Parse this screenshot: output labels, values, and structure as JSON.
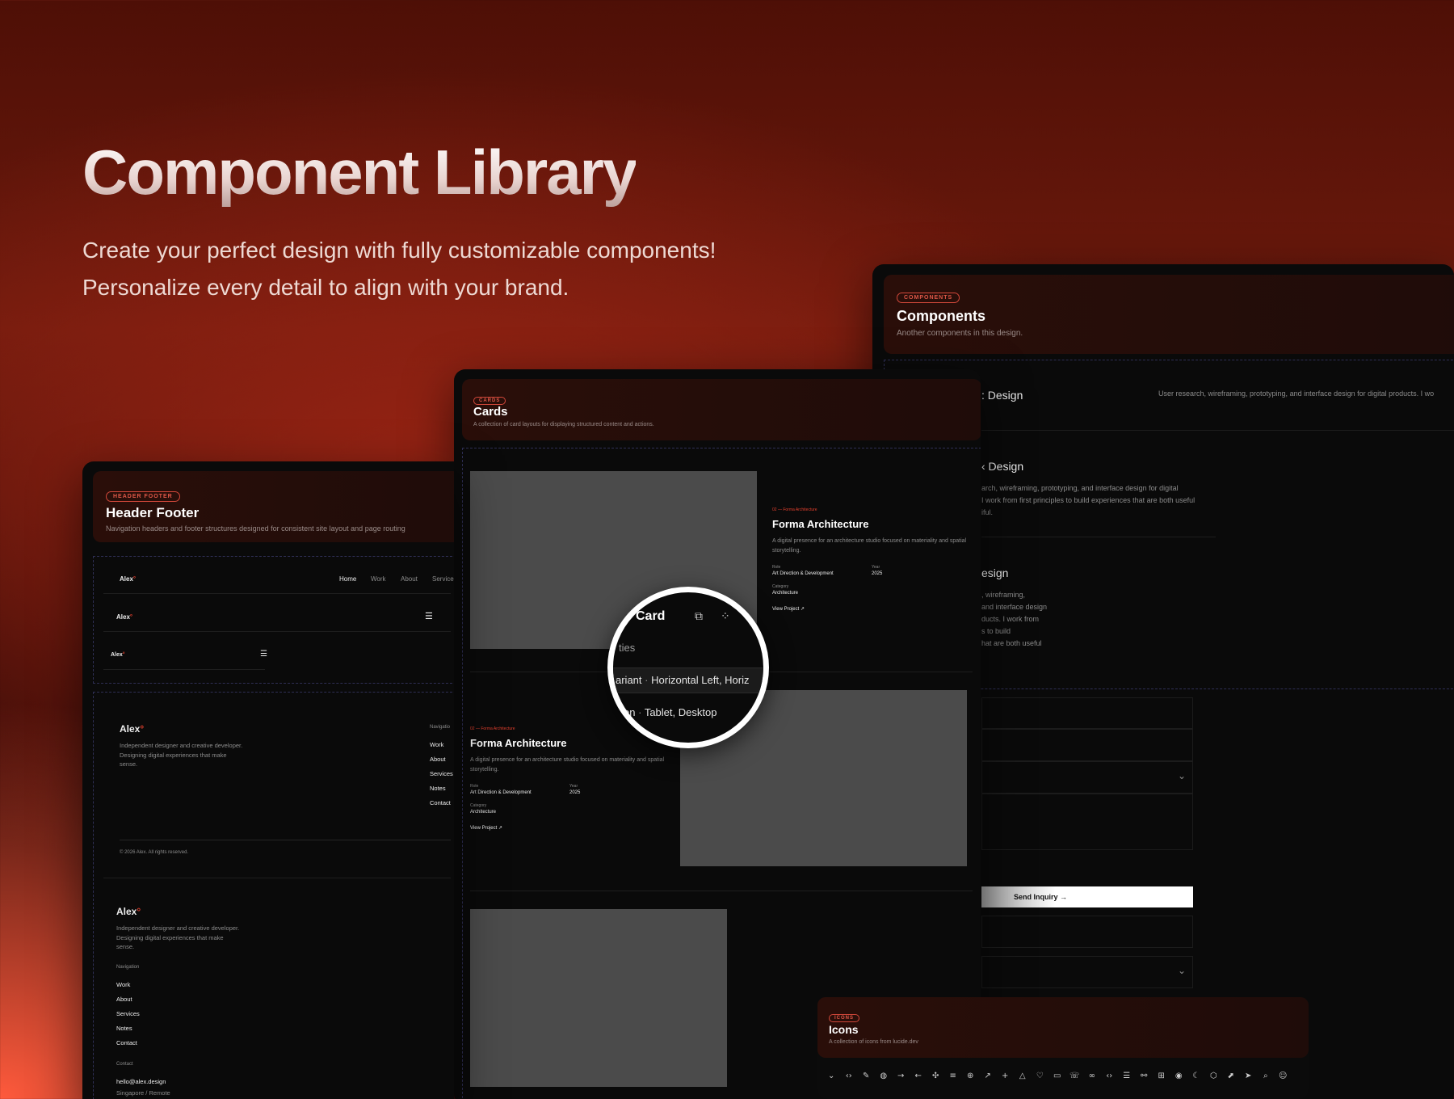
{
  "hero": {
    "title": "Component Library",
    "subtitle": "Create your perfect design with fully customizable components! Personalize every detail to align with your brand."
  },
  "header_footer": {
    "tag": "HEADER FOOTER",
    "title": "Header Footer",
    "description": "Navigation headers and footer structures designed for consistent site layout and page routing",
    "brand": "Alex",
    "nav": [
      "Home",
      "Work",
      "About",
      "Service"
    ],
    "menu_icon": "☰",
    "footer_bio": "Independent designer and creative developer. Designing digital experiences that make sense.",
    "nav_heading": "Navigation",
    "nav_heading_short": "Navigatio",
    "footer_links": [
      "Work",
      "About",
      "Services",
      "Notes",
      "Contact"
    ],
    "copyright": "© 2026 Alex. All rights reserved.",
    "contact_heading": "Contact",
    "email": "hello@alex.design",
    "location": "Singapore / Remote"
  },
  "cards": {
    "tag": "CARDS",
    "title": "Cards",
    "description": "A collection of card layouts for displaying structured content and actions.",
    "eyebrow": "02 — Forma Architecture",
    "card_title": "Forma Architecture",
    "card_desc": "A digital presence for an architecture studio focused on materiality and spatial storytelling.",
    "role_label": "Role",
    "role": "Art Direction & Development",
    "year_label": "Year",
    "year": "2025",
    "category_label": "Category",
    "category": "Architecture",
    "link": "View Project ↗"
  },
  "zoom": {
    "title": "Card",
    "row1": "ties",
    "row2_a": "ariant",
    "row2_b": "Horizontal Left, Horiz",
    "row3_a": "en",
    "row3_b": "Tablet, Desktop",
    "sep": "·"
  },
  "components": {
    "tag": "COMPONENTS",
    "title": "Components",
    "description": "Another components in this design.",
    "s1_title": ": Design",
    "s1_desc": "User research, wireframing, prototyping, and interface design for digital products. I wo",
    "s2_title": "‹ Design",
    "s2_desc": [
      "arch, wireframing, prototyping, and interface design for digital",
      "I work from first principles to build experiences that are both useful",
      "iful."
    ],
    "s3_title": "esign",
    "s3_desc": [
      ", wireframing,",
      "and interface design",
      "ducts. I work from",
      "s to build",
      "hat are both useful"
    ],
    "send": "Send Inquiry →",
    "chev": "⌄"
  },
  "icons": {
    "tag": "ICONS",
    "title": "Icons",
    "description": "A collection of icons from lucide.dev",
    "glyphs": [
      "⌄",
      "‹›",
      "✎",
      "◍",
      "→",
      "←",
      "✣",
      "≡",
      "⊕",
      "↗",
      "+",
      "△",
      "♡",
      "▭",
      "☏",
      "∞",
      "‹›",
      "☰",
      "⚯",
      "⊞",
      "◉",
      "☾",
      "⬡",
      "⬈",
      "➤",
      "⌕",
      "☺"
    ]
  }
}
